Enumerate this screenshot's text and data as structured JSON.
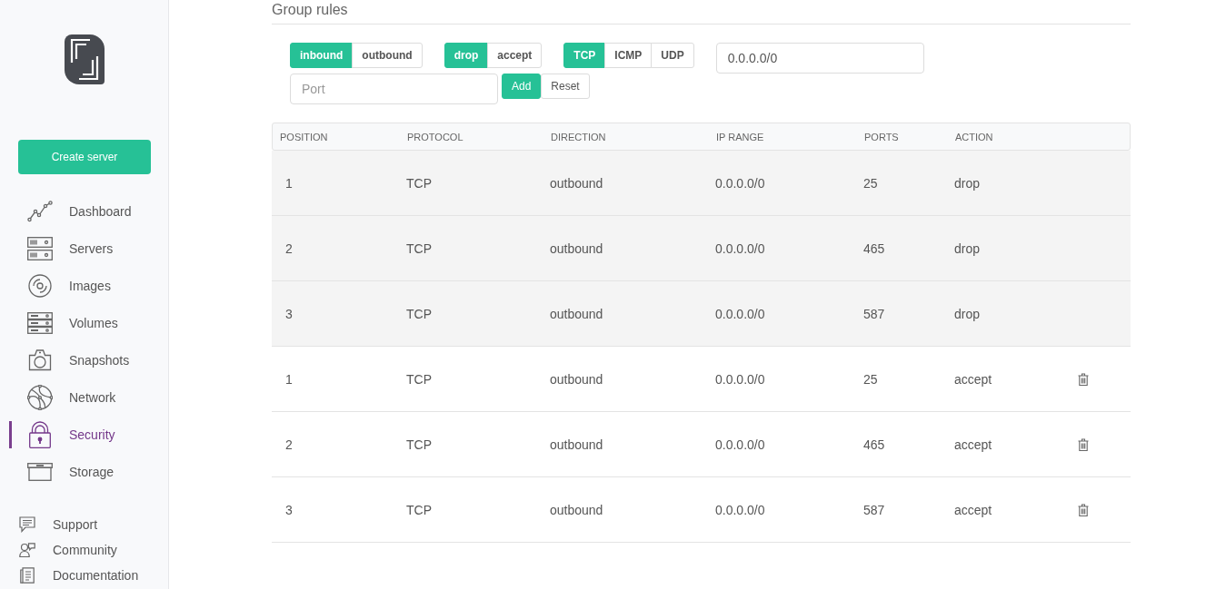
{
  "page": {
    "title": "Group rules"
  },
  "sidebar": {
    "create_button": "Create server",
    "items": [
      {
        "label": "Dashboard",
        "selected": false
      },
      {
        "label": "Servers",
        "selected": false
      },
      {
        "label": "Images",
        "selected": false
      },
      {
        "label": "Volumes",
        "selected": false
      },
      {
        "label": "Snapshots",
        "selected": false
      },
      {
        "label": "Network",
        "selected": false
      },
      {
        "label": "Security",
        "selected": true
      },
      {
        "label": "Storage",
        "selected": false
      }
    ],
    "links": [
      "Support",
      "Community",
      "Documentation"
    ]
  },
  "rule_form": {
    "direction": [
      {
        "label": "inbound",
        "selected": true
      },
      {
        "label": "outbound",
        "selected": false
      }
    ],
    "action": [
      {
        "label": "drop",
        "selected": true
      },
      {
        "label": "accept",
        "selected": false
      }
    ],
    "protocol": [
      {
        "label": "TCP",
        "selected": true
      },
      {
        "label": "ICMP",
        "selected": false
      },
      {
        "label": "UDP",
        "selected": false
      }
    ],
    "ip_range": {
      "value": "0.0.0.0/0"
    },
    "port": {
      "placeholder": "Port"
    },
    "buttons": [
      {
        "label": "Add",
        "kind": "primary"
      },
      {
        "label": "Reset",
        "kind": "secondary"
      }
    ]
  },
  "table": {
    "columns": [
      "POSITION",
      "PROTOCOL",
      "DIRECTION",
      "IP RANGE",
      "PORTS",
      "ACTION"
    ],
    "rows": [
      {
        "cells": [
          "1",
          "TCP",
          "outbound",
          "0.0.0.0/0",
          "25",
          "drop"
        ],
        "removable": false
      },
      {
        "cells": [
          "2",
          "TCP",
          "outbound",
          "0.0.0.0/0",
          "465",
          "drop"
        ],
        "removable": false
      },
      {
        "cells": [
          "3",
          "TCP",
          "outbound",
          "0.0.0.0/0",
          "587",
          "drop"
        ],
        "removable": false
      },
      {
        "cells": [
          "1",
          "TCP",
          "outbound",
          "0.0.0.0/0",
          "25",
          "accept"
        ],
        "removable": true
      },
      {
        "cells": [
          "2",
          "TCP",
          "outbound",
          "0.0.0.0/0",
          "465",
          "accept"
        ],
        "removable": true
      },
      {
        "cells": [
          "3",
          "TCP",
          "outbound",
          "0.0.0.0/0",
          "587",
          "accept"
        ],
        "removable": true
      }
    ]
  }
}
